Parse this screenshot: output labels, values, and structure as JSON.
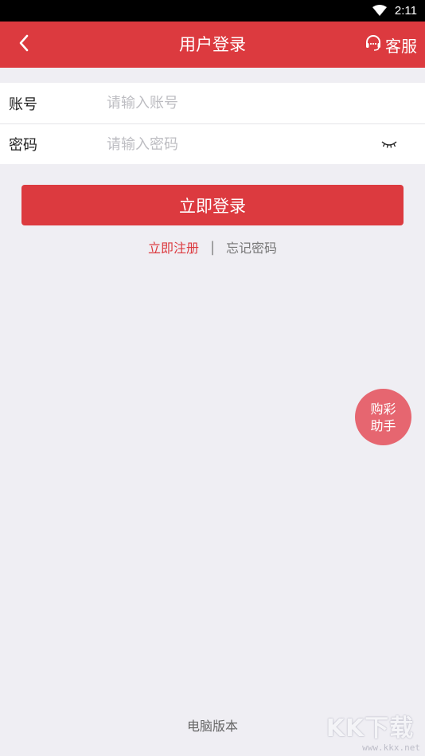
{
  "status_bar": {
    "time": "2:11",
    "icons": [
      "wifi-icon",
      "battery-icon"
    ]
  },
  "header": {
    "title": "用户登录",
    "back_icon": "chevron-left-icon",
    "service_label": "客服",
    "service_icon": "headset-icon"
  },
  "form": {
    "account": {
      "label": "账号",
      "placeholder": "请输入账号",
      "value": ""
    },
    "password": {
      "label": "密码",
      "placeholder": "请输入密码",
      "value": "",
      "toggle_icon": "eye-closed-icon"
    }
  },
  "login_button": "立即登录",
  "links": {
    "register": "立即注册",
    "separator": "|",
    "forgot": "忘记密码"
  },
  "assistant": {
    "line1": "购彩",
    "line2": "助手"
  },
  "footer": {
    "desktop_version": "电脑版本"
  },
  "watermark": {
    "logo": "KK下载",
    "url": "www.kkx.net"
  },
  "colors": {
    "brand": "#dc3a3f",
    "background": "#efeef3",
    "assistant": "#e66670"
  }
}
